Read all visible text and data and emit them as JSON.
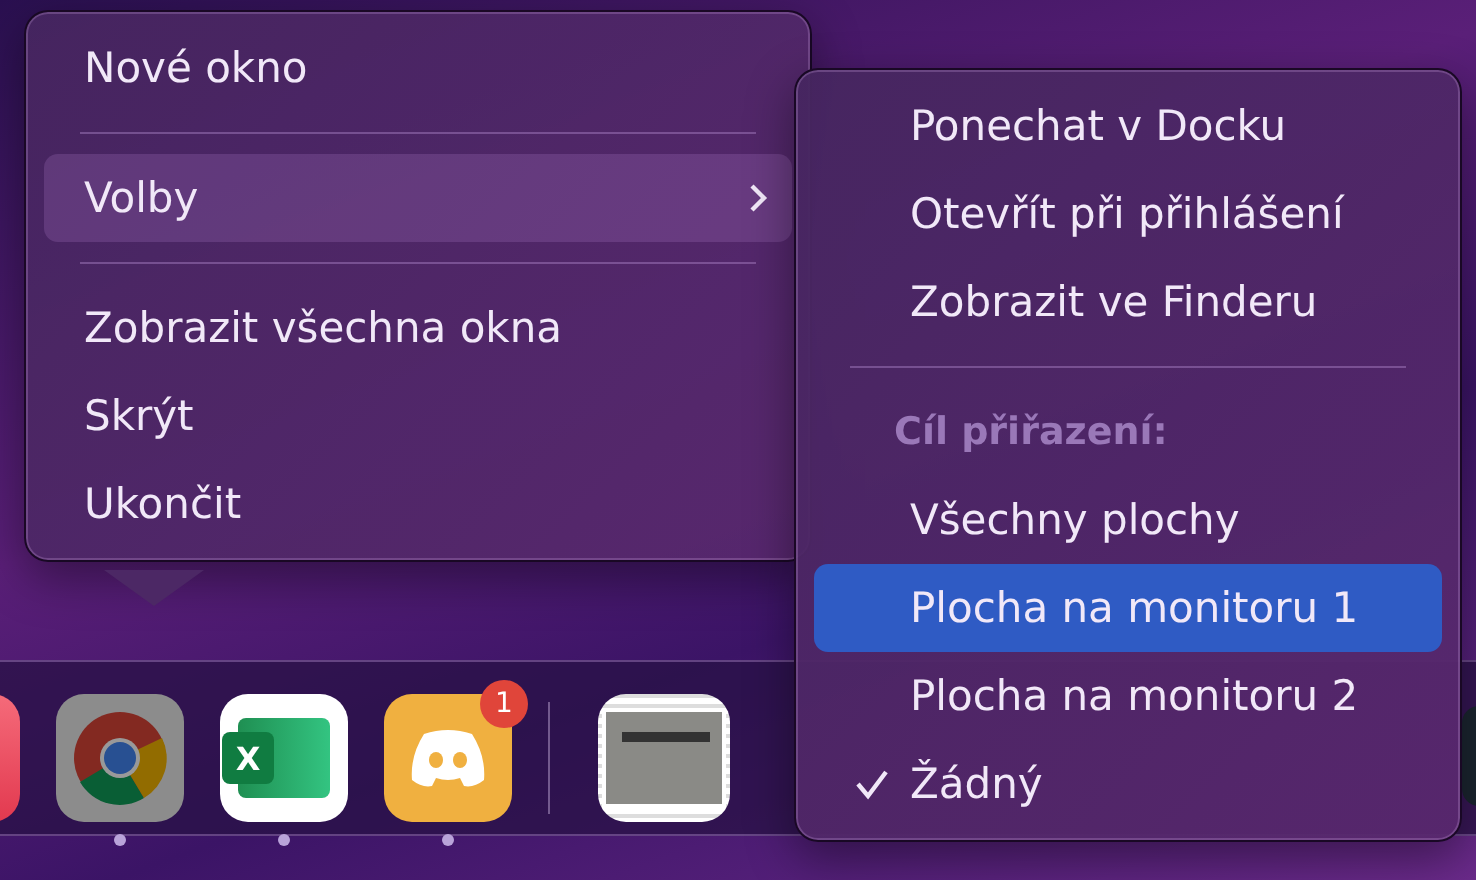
{
  "dock": {
    "apps": [
      {
        "kind": "red-app",
        "pressed": false
      },
      {
        "kind": "chrome",
        "running": true,
        "pressed": true
      },
      {
        "kind": "excel",
        "running": true,
        "pressed": false,
        "glyph": "X"
      },
      {
        "kind": "discord",
        "running": true,
        "pressed": false,
        "badge": "1"
      },
      {
        "kind": "divider"
      },
      {
        "kind": "stack",
        "pressed": false
      },
      {
        "kind": "thumbnail",
        "pressed": false
      }
    ]
  },
  "main_menu": {
    "items": [
      {
        "kind": "item",
        "label": "Nové okno",
        "highlighted": false
      },
      {
        "kind": "separator"
      },
      {
        "kind": "submenu",
        "label": "Volby",
        "highlighted": true
      },
      {
        "kind": "separator"
      },
      {
        "kind": "item",
        "label": "Zobrazit všechna okna",
        "highlighted": false
      },
      {
        "kind": "item",
        "label": "Skrýt",
        "highlighted": false
      },
      {
        "kind": "item",
        "label": "Ukončit",
        "highlighted": false
      }
    ]
  },
  "submenu": {
    "items": [
      {
        "kind": "item",
        "label": "Ponechat v Docku",
        "highlighted": false,
        "checked": false
      },
      {
        "kind": "item",
        "label": "Otevřít při přihlášení",
        "highlighted": false,
        "checked": false
      },
      {
        "kind": "item",
        "label": "Zobrazit ve Finderu",
        "highlighted": false,
        "checked": false
      },
      {
        "kind": "separator"
      },
      {
        "kind": "header",
        "label": "Cíl přiřazení:"
      },
      {
        "kind": "item",
        "label": "Všechny plochy",
        "highlighted": false,
        "checked": false
      },
      {
        "kind": "item",
        "label": "Plocha na monitoru 1",
        "highlighted": true,
        "checked": false
      },
      {
        "kind": "item",
        "label": "Plocha na monitoru 2",
        "highlighted": false,
        "checked": false
      },
      {
        "kind": "item",
        "label": "Žádný",
        "highlighted": false,
        "checked": true
      }
    ]
  }
}
